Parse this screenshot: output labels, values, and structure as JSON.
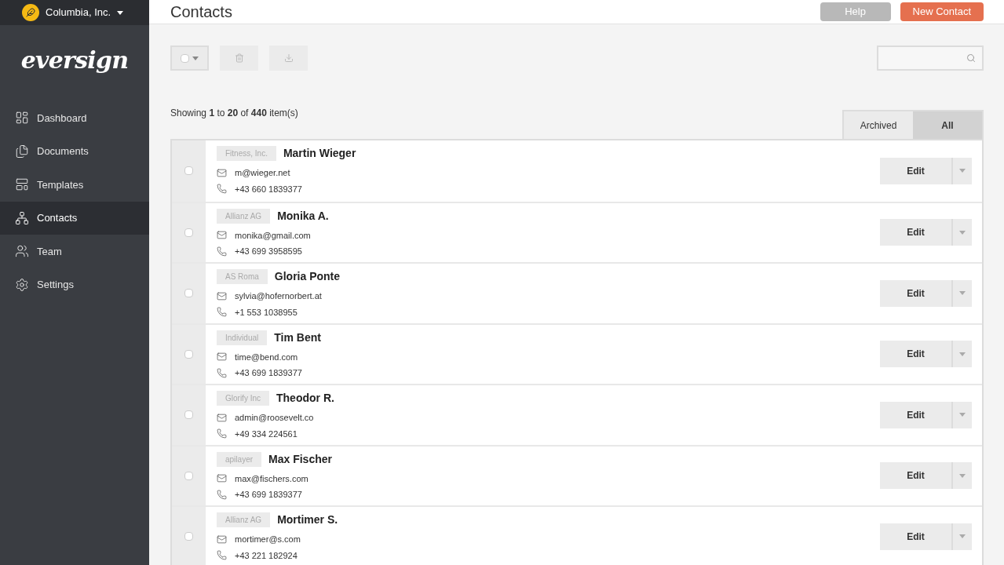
{
  "account": {
    "name": "Columbia, Inc."
  },
  "logo": "eversign",
  "sidebar": {
    "items": [
      {
        "label": "Dashboard",
        "selected": false
      },
      {
        "label": "Documents",
        "selected": false
      },
      {
        "label": "Templates",
        "selected": false
      },
      {
        "label": "Contacts",
        "selected": true
      },
      {
        "label": "Team",
        "selected": false
      },
      {
        "label": "Settings",
        "selected": false
      }
    ]
  },
  "page": {
    "title": "Contacts",
    "buttons": [
      {
        "label": "Help",
        "kind": "secondary"
      },
      {
        "label": "New Contact",
        "kind": "primary"
      }
    ]
  },
  "toolbar": {
    "select_all_checked": false
  },
  "summary": "Showing **1** to **20** of **440** item(s)",
  "filter_tabs": [
    {
      "label": "Archived",
      "selected": false
    },
    {
      "label": "All",
      "selected": true
    }
  ],
  "contacts": [
    {
      "company": "Fitness, Inc.",
      "name": "Martin Wieger",
      "email": "m@wieger.net",
      "phone": "+43 660 1839377",
      "checked": false,
      "action": "Edit"
    },
    {
      "company": "Allianz AG",
      "name": "Monika A.",
      "email": "monika@gmail.com",
      "phone": "+43 699 3958595",
      "checked": false,
      "action": "Edit"
    },
    {
      "company": "AS Roma",
      "name": "Gloria Ponte",
      "email": "sylvia@hofernorbert.at",
      "phone": "+1 553 1038955",
      "checked": false,
      "action": "Edit"
    },
    {
      "company": "Individual",
      "name": "Tim Bent",
      "email": "time@bend.com",
      "phone": "+43 699 1839377",
      "checked": false,
      "action": "Edit"
    },
    {
      "company": "Glorify Inc",
      "name": "Theodor R.",
      "email": "admin@roosevelt.co",
      "phone": "+49 334 224561",
      "checked": false,
      "action": "Edit"
    },
    {
      "company": "apilayer",
      "name": "Max Fischer",
      "email": "max@fischers.com",
      "phone": "+43 699 1839377",
      "checked": false,
      "action": "Edit"
    },
    {
      "company": "Allianz AG",
      "name": "Mortimer S.",
      "email": "mortimer@s.com",
      "phone": "+43 221 182924",
      "checked": false,
      "action": "Edit"
    }
  ]
}
